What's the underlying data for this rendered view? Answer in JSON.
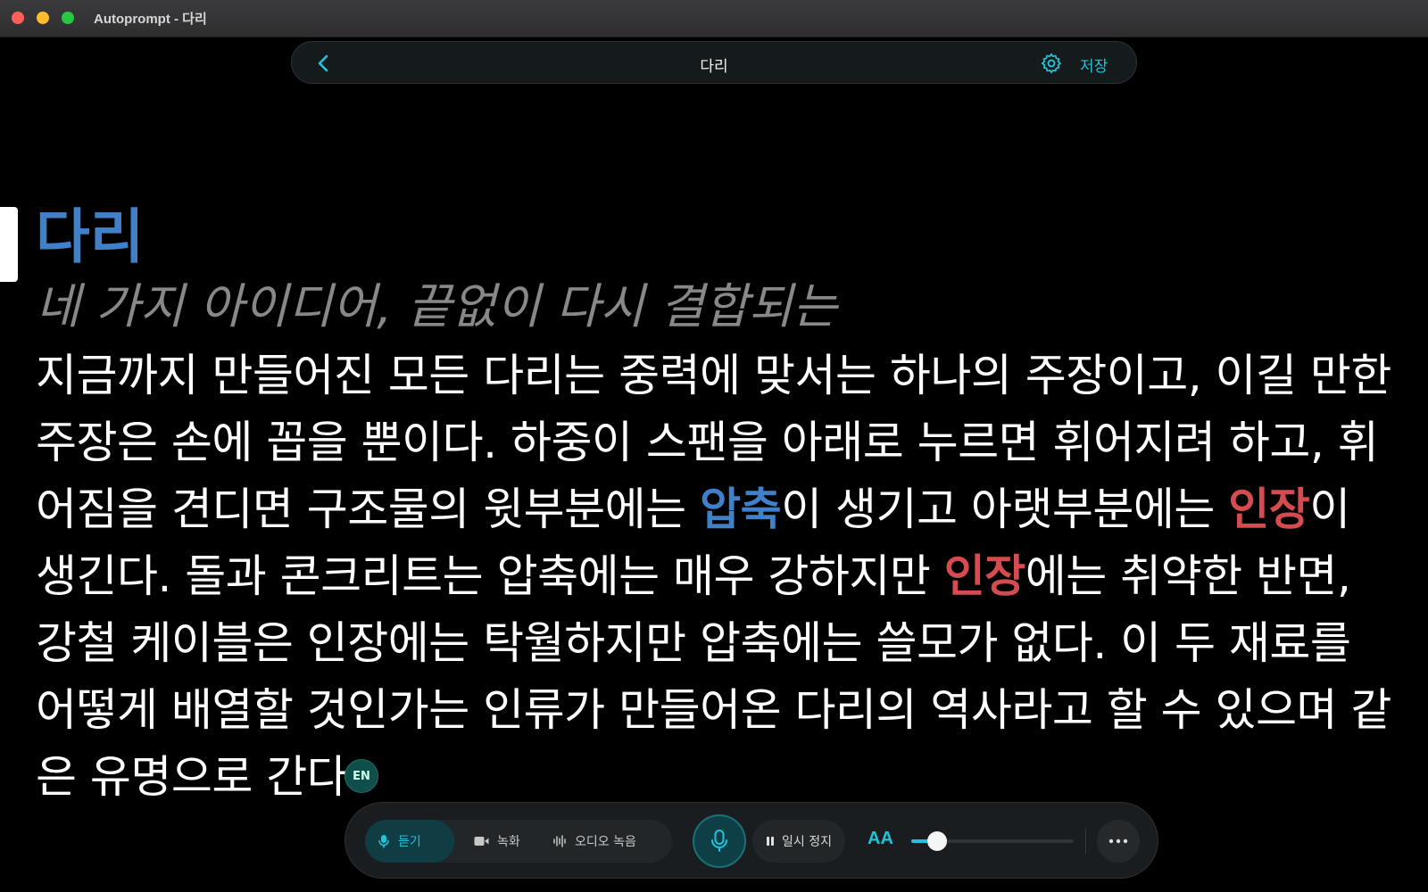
{
  "window": {
    "title": "Autoprompt - 다리"
  },
  "topbar": {
    "title": "다리",
    "save_label": "저장"
  },
  "script": {
    "heading": "다리",
    "subtitle": "네 가지 아이디어, 끝없이 다시 결합되는",
    "body": [
      {
        "text": "지금까지 만들어진 모든 다리는 중력에 맞서는 하나의 주장이고, 이길 만한 주장은 손에 꼽을 뿐이다. 하중이 스팬을 아래로 누르면 휘어지려 하고, 휘어짐을 견디면 구조물의 윗부분에는 "
      },
      {
        "text": "압축",
        "highlight": "blue"
      },
      {
        "text": "이 생기고 아랫부분에는 "
      },
      {
        "text": "인장",
        "highlight": "red"
      },
      {
        "text": "이 생긴다. 돌과 콘크리트는 압축에는 매우 강하지만 "
      },
      {
        "text": "인장",
        "highlight": "red"
      },
      {
        "text": "에는 취약한 반면, 강철 케이블은 인장에는 탁월하지만 압축에는 쓸모가 없다. 이 두 재료를 어떻게 배열할 것인가는 인류가 만들어온 다리의 역사라고 할 수 있으며 같은 유명으로 "
      },
      {
        "text": "간다"
      }
    ]
  },
  "language_badge": "EN",
  "controls": {
    "modes": [
      {
        "label": "듣기",
        "icon": "mic-icon",
        "active": true
      },
      {
        "label": "녹화",
        "icon": "video-icon",
        "active": false
      },
      {
        "label": "오디오 녹음",
        "icon": "waveform-icon",
        "active": false
      }
    ],
    "pause_label": "일시 정지",
    "font_size_label": "AA",
    "font_size_level": 0.16
  },
  "colors": {
    "accent": "#22c3d8",
    "heading_blue": "#3f80c8",
    "highlight_red": "#d44c4f"
  }
}
